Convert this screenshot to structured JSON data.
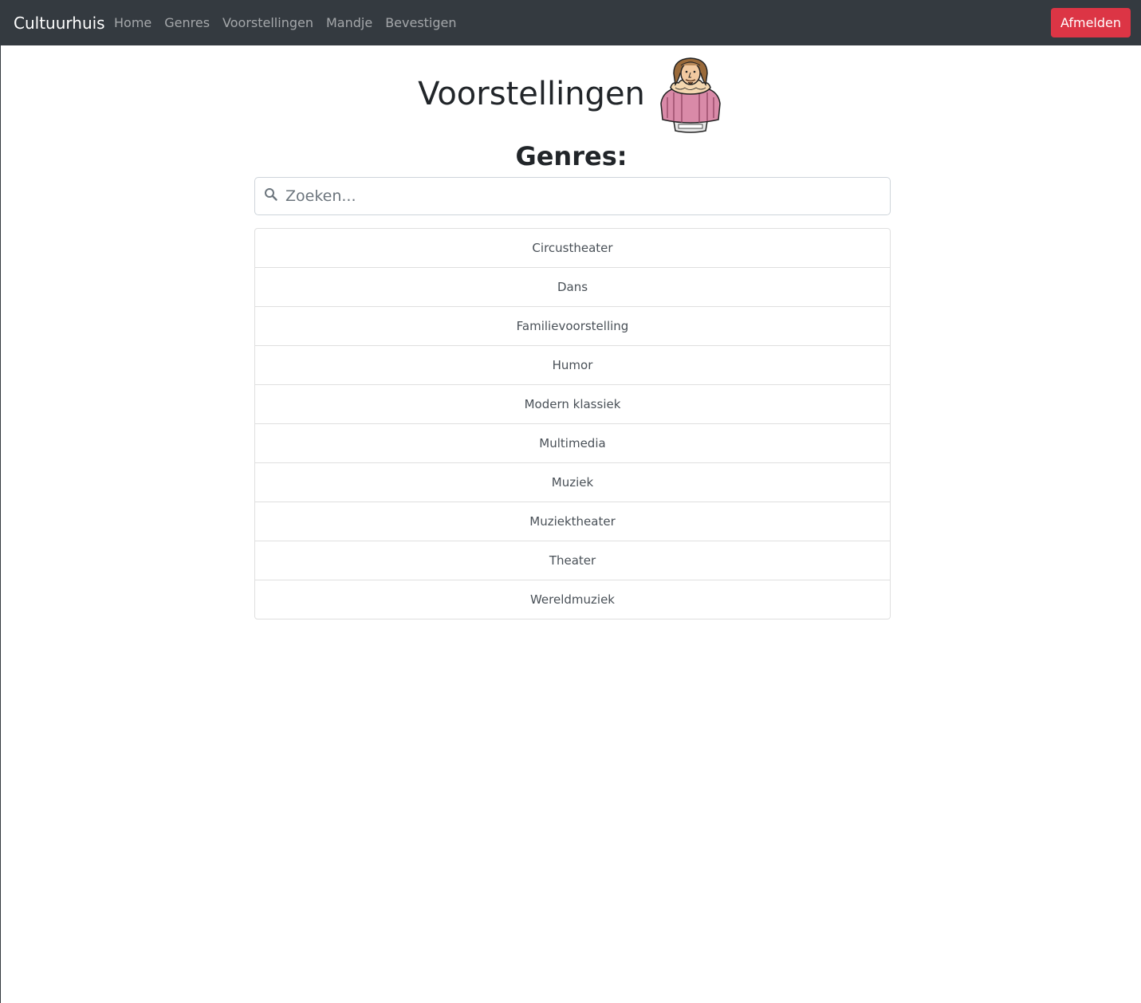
{
  "navbar": {
    "brand": "Cultuurhuis",
    "links": [
      {
        "label": "Home"
      },
      {
        "label": "Genres"
      },
      {
        "label": "Voorstellingen"
      },
      {
        "label": "Mandje"
      },
      {
        "label": "Bevestigen"
      }
    ],
    "logout_label": "Afmelden",
    "logout_color": "#dc3545",
    "background": "#343a40"
  },
  "page": {
    "title": "Voorstellingen",
    "mascot_icon": "shakespeare-bust-icon",
    "subtitle": "Genres:"
  },
  "search": {
    "placeholder": "Zoeken...",
    "value": "",
    "icon": "search-icon"
  },
  "genres": [
    {
      "label": "Circustheater"
    },
    {
      "label": "Dans"
    },
    {
      "label": "Familievoorstelling"
    },
    {
      "label": "Humor"
    },
    {
      "label": "Modern klassiek"
    },
    {
      "label": "Multimedia"
    },
    {
      "label": "Muziek"
    },
    {
      "label": "Muziektheater"
    },
    {
      "label": "Theater"
    },
    {
      "label": "Wereldmuziek"
    }
  ]
}
